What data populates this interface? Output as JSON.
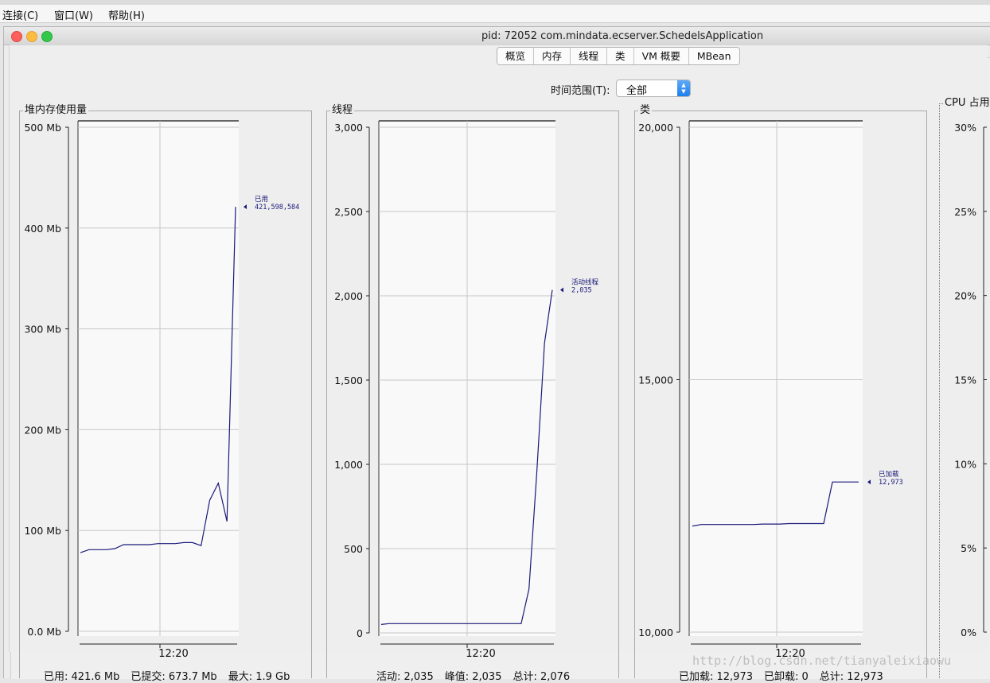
{
  "menubar": {
    "items": [
      "连接(C)",
      "窗口(W)",
      "帮助(H)"
    ]
  },
  "window": {
    "title": "pid: 72052 com.mindata.ecserver.SchedelsApplication"
  },
  "tabs": [
    {
      "label": "概览",
      "active": true
    },
    {
      "label": "内存",
      "active": false
    },
    {
      "label": "线程",
      "active": false
    },
    {
      "label": "类",
      "active": false
    },
    {
      "label": "VM 概要",
      "active": false
    },
    {
      "label": "MBean",
      "active": false
    }
  ],
  "time_range": {
    "label": "时间范围(T):",
    "value": "全部"
  },
  "panels": {
    "heap": {
      "title": "堆内存使用量",
      "summary": [
        "已用: 421.6 Mb",
        "已提交: 673.7 Mb",
        "最大: 1.9 Gb"
      ]
    },
    "threads": {
      "title": "线程",
      "summary": [
        "活动: 2,035",
        "峰值: 2,035",
        "总计: 2,076"
      ]
    },
    "classes": {
      "title": "类",
      "summary": [
        "已加载: 12,973",
        "已卸载: 0",
        "总计: 12,973"
      ]
    },
    "cpu": {
      "title": "CPU 占用"
    }
  },
  "chart_data": [
    {
      "type": "line",
      "title": "堆内存使用量",
      "y_ticks": [
        "0.0 Mb",
        "100 Mb",
        "200 Mb",
        "300 Mb",
        "400 Mb",
        "500 Mb"
      ],
      "ylim": [
        0,
        500
      ],
      "x_tick_label": "12:20",
      "series": [
        {
          "name": "已用",
          "last_value_label": "421,598,584",
          "values": [
            78,
            81,
            81,
            81,
            82,
            86,
            86,
            86,
            86,
            87,
            87,
            87,
            88,
            88,
            85,
            130,
            147,
            109,
            421
          ]
        }
      ],
      "color": "#1a1a7a"
    },
    {
      "type": "line",
      "title": "线程",
      "y_ticks": [
        "0",
        "500",
        "1,000",
        "1,500",
        "2,000",
        "2,500",
        "3,000"
      ],
      "ylim": [
        0,
        3000
      ],
      "x_tick_label": "12:20",
      "series": [
        {
          "name": "活动线程",
          "last_value_label": "2,035",
          "values": [
            50,
            55,
            55,
            55,
            55,
            55,
            55,
            55,
            55,
            55,
            55,
            55,
            55,
            55,
            55,
            55,
            55,
            55,
            55,
            260,
            950,
            1720,
            2035
          ]
        }
      ],
      "color": "#1a1a7a"
    },
    {
      "type": "line",
      "title": "类",
      "y_ticks": [
        "10,000",
        "15,000",
        "20,000"
      ],
      "ylim": [
        10000,
        20000
      ],
      "x_tick_label": "12:20",
      "series": [
        {
          "name": "已加载",
          "last_value_label": "12,973",
          "values": [
            12100,
            12130,
            12130,
            12130,
            12130,
            12130,
            12130,
            12130,
            12140,
            12140,
            12140,
            12150,
            12150,
            12150,
            12150,
            12150,
            12973,
            12973,
            12973,
            12973
          ]
        }
      ],
      "color": "#1a1a7a"
    },
    {
      "type": "line",
      "title": "CPU 占用",
      "y_ticks": [
        "0%",
        "5%",
        "10%",
        "15%",
        "20%",
        "25%",
        "30%"
      ],
      "ylim": [
        0,
        30
      ],
      "series": []
    }
  ],
  "watermark": "http://blog.csdn.net/tianyaleixiaowu"
}
